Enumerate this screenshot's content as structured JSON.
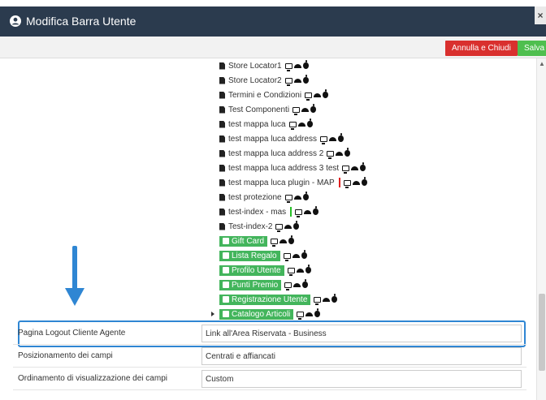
{
  "window": {
    "title": "Modifica Barra Utente",
    "close_label": "×"
  },
  "toolbar": {
    "cancel_label": "Annulla e Chiudi",
    "save_label": "Salva"
  },
  "tree": {
    "pages": [
      {
        "label": "Store Locator1"
      },
      {
        "label": "Store Locator2"
      },
      {
        "label": "Termini e Condizioni"
      },
      {
        "label": "Test Componenti"
      },
      {
        "label": "test mappa luca"
      },
      {
        "label": "test mappa luca address"
      },
      {
        "label": "test mappa luca address 2"
      },
      {
        "label": "test mappa luca address 3 test"
      },
      {
        "label": "test mappa luca plugin - MAP"
      },
      {
        "label": "test protezione"
      },
      {
        "label": "test-index - mas"
      },
      {
        "label": "Test-index-2"
      }
    ],
    "sections": [
      {
        "label": "Gift Card"
      },
      {
        "label": "Lista Regalo"
      },
      {
        "label": "Profilo Utente"
      },
      {
        "label": "Punti Premio"
      },
      {
        "label": "Registrazione Utente"
      },
      {
        "label": "Catalogo Articoli"
      }
    ]
  },
  "form": {
    "rows": [
      {
        "label": "Pagina Logout Cliente Agente",
        "value": "Link all'Area Riservata - Business"
      },
      {
        "label": "Posizionamento dei campi",
        "value": "Centrati e affiancati"
      },
      {
        "label": "Ordinamento di visualizzazione dei campi",
        "value": "Custom"
      }
    ]
  },
  "colors": {
    "header_bg": "#2b3b4e",
    "cancel_button": "#d9302e",
    "save_button": "#4fbf4f",
    "green_label": "#43b55c",
    "highlight": "#2f86d3"
  },
  "icons": [
    "user-circle-icon",
    "close-icon",
    "document-icon",
    "desktop-icon",
    "android-icon",
    "apple-icon",
    "down-arrow-annotation"
  ]
}
